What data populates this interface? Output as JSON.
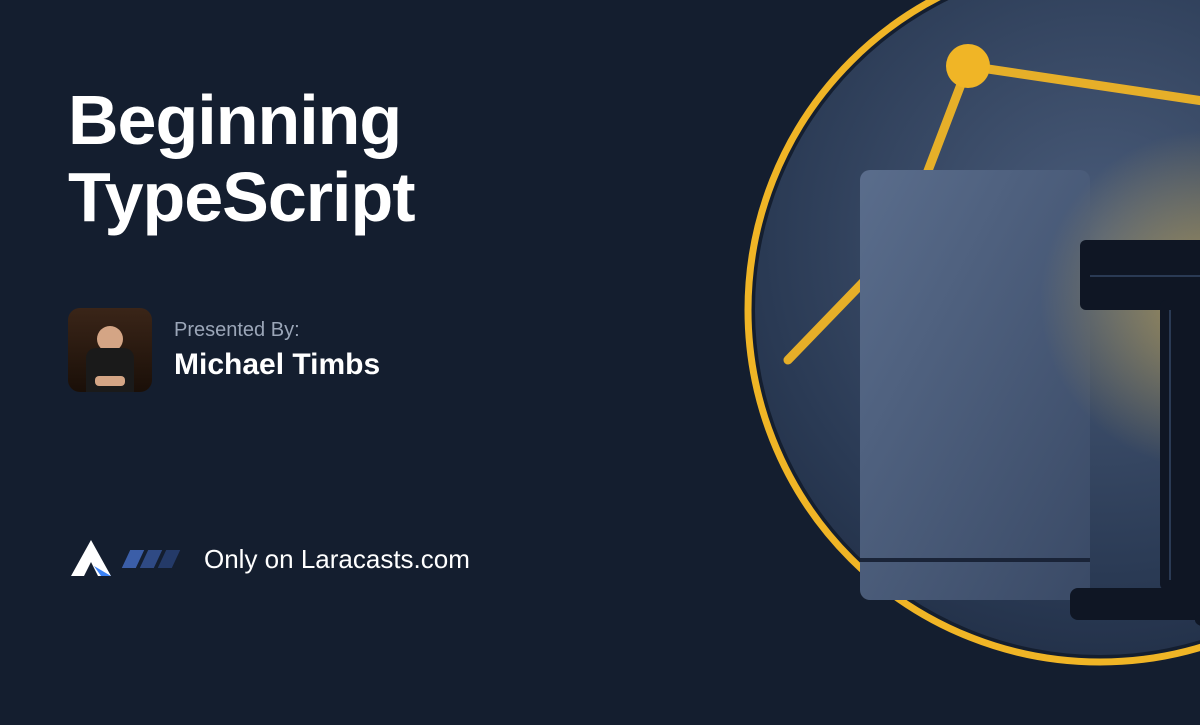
{
  "course": {
    "title_line1": "Beginning",
    "title_line2": "TypeScript"
  },
  "presenter": {
    "label": "Presented By:",
    "name": "Michael Timbs"
  },
  "footer": {
    "text": "Only on Laracasts.com"
  },
  "colors": {
    "background": "#141e2f",
    "accent_yellow": "#f0b526",
    "accent_blue": "#3b82f6"
  }
}
